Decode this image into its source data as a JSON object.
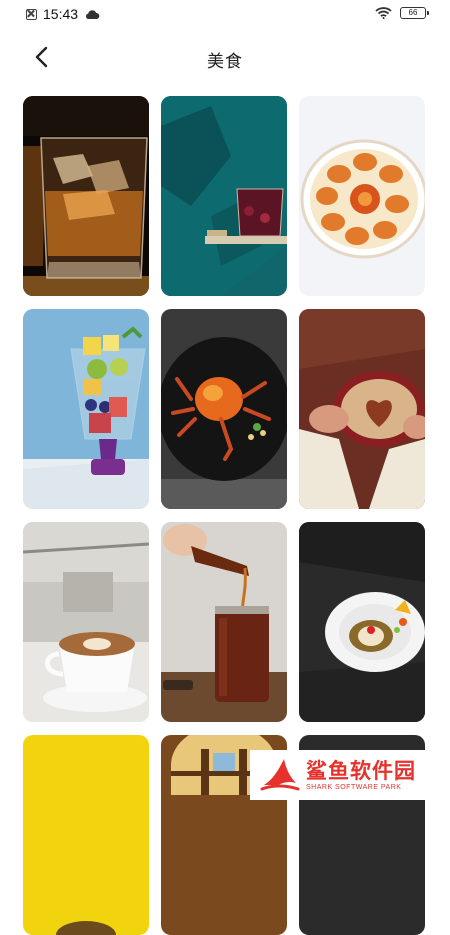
{
  "status_bar": {
    "time": "15:43",
    "battery": "66"
  },
  "header": {
    "title": "美食"
  },
  "gallery": {
    "items": [
      {
        "name": "whiskey-photo",
        "subject": "whiskey on the rocks"
      },
      {
        "name": "berry-drink-photo",
        "subject": "berry drink on teal wall shelf"
      },
      {
        "name": "crab-platter-photo",
        "subject": "crab platter"
      },
      {
        "name": "fruit-parfait-photo",
        "subject": "fruit parfait glass"
      },
      {
        "name": "crab-dish-photo",
        "subject": "plated crab on black plate"
      },
      {
        "name": "heart-latte-photo",
        "subject": "heart latte held in hands"
      },
      {
        "name": "latte-art-photo",
        "subject": "latte art cup"
      },
      {
        "name": "iced-tea-photo",
        "subject": "pouring iced tea"
      },
      {
        "name": "dessert-plate-photo",
        "subject": "white dessert plate on dark background"
      },
      {
        "name": "yellow-tile-photo",
        "subject": "yellow background food"
      },
      {
        "name": "window-tile-photo",
        "subject": "stained window interior"
      },
      {
        "name": "dark-tile-photo",
        "subject": "dark food photo"
      }
    ]
  },
  "watermark": {
    "brand": "鲨鱼软件园",
    "tagline": "SHARK SOFTWARE PARK"
  },
  "colors": {
    "accent": "#e5322d",
    "text": "#222222",
    "background": "#ffffff"
  },
  "icons": {
    "back": "chevron-left-icon",
    "wifi": "wifi-icon",
    "cloud": "cloud-icon",
    "notification": "close-box-icon"
  }
}
